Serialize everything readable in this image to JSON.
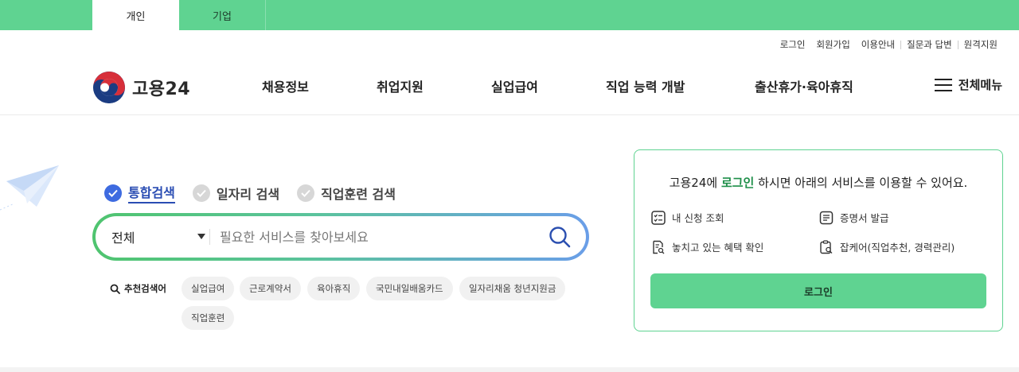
{
  "top_tabs": [
    {
      "label": "개인",
      "active": true
    },
    {
      "label": "기업",
      "active": false
    }
  ],
  "utility_links": [
    "로그인",
    "회원가입",
    "이용안내",
    "질문과 답변",
    "원격지원"
  ],
  "logo": {
    "text": "고용24"
  },
  "gnb": [
    "채용정보",
    "취업지원",
    "실업급여",
    "직업 능력 개발",
    "출산휴가·육아휴직"
  ],
  "all_menu": {
    "label": "전체메뉴"
  },
  "search": {
    "types": [
      {
        "label": "통합검색",
        "selected": true
      },
      {
        "label": "일자리 검색",
        "selected": false
      },
      {
        "label": "직업훈련 검색",
        "selected": false
      }
    ],
    "scope_value": "전체",
    "placeholder": "필요한 서비스를 찾아보세요",
    "recommended_label": "추천검색어",
    "recommended": [
      "실업급여",
      "근로계약서",
      "육아휴직",
      "국민내일배움카드",
      "일자리채움 청년지원금",
      "직업훈련"
    ]
  },
  "login_panel": {
    "title_prefix": "고용24에 ",
    "title_highlight": "로그인",
    "title_suffix": " 하시면 아래의 서비스를 이용할 수 있어요.",
    "services": [
      {
        "label": "내 신청 조회",
        "icon": "checklist-icon"
      },
      {
        "label": "증명서 발급",
        "icon": "certificate-icon"
      },
      {
        "label": "놓치고 있는 혜택 확인",
        "icon": "document-search-icon"
      },
      {
        "label": "잡케어(직업추천, 경력관리)",
        "icon": "clipboard-search-icon"
      }
    ],
    "button_label": "로그인"
  },
  "colors": {
    "brand_green": "#5fd391",
    "highlight_green": "#1f8f4a",
    "accent_blue": "#3e6be0"
  }
}
